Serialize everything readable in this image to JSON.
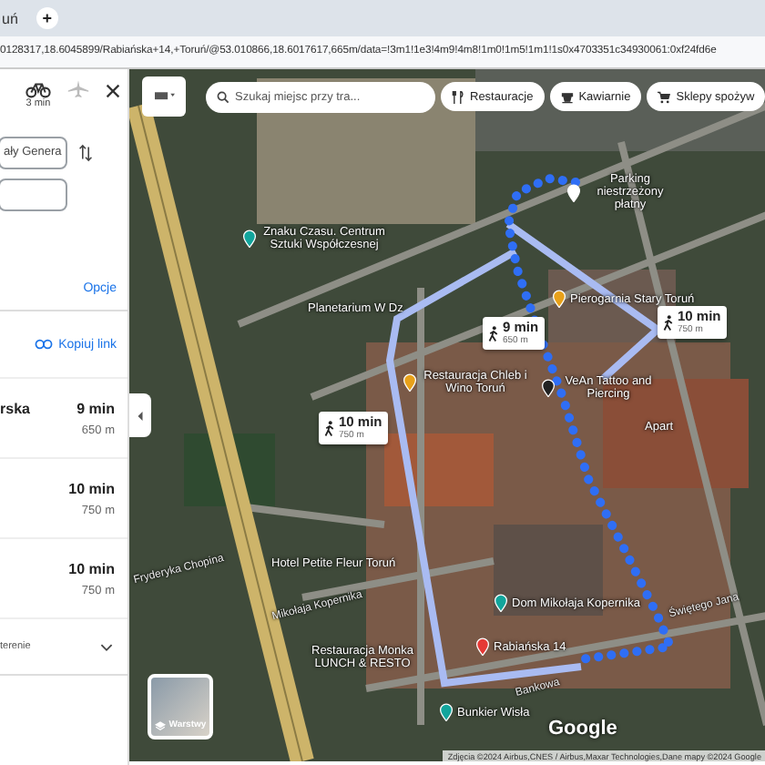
{
  "browser": {
    "tab_title": "uń",
    "new_tab": "+",
    "url": "0128317,18.6045899/Rabiańska+14,+Toruń/@53.010866,18.6017617,665m/data=!3m1!1e3!4m9!4m8!1m0!1m5!1m1!1s0x4703351c34930061:0xf24fd6e"
  },
  "directions": {
    "modes": [
      {
        "kind": "bike",
        "time": "3 min"
      },
      {
        "kind": "plane"
      }
    ],
    "origin": {
      "value": "ały Genera"
    },
    "options_link": "Opcje",
    "copy_link": "Kopiuj link",
    "routes": [
      {
        "name": "rska",
        "time": "9 min",
        "distance": "650 m"
      },
      {
        "time": "10 min",
        "distance": "750 m"
      },
      {
        "time": "10 min",
        "distance": "750 m"
      }
    ],
    "terrain": {
      "label": "terenie",
      "expanded": false
    }
  },
  "map": {
    "search": {
      "placeholder": "Szukaj miejsc przy tra..."
    },
    "chips": [
      {
        "kind": "restaurant",
        "label": "Restauracje"
      },
      {
        "kind": "cafe",
        "label": "Kawiarnie"
      },
      {
        "kind": "shop",
        "label": "Sklepy spożyw"
      }
    ],
    "route_labels": [
      {
        "time": "9 min",
        "distance": "650 m"
      },
      {
        "time": "10 min",
        "distance": "750 m"
      },
      {
        "time": "10 min",
        "distance": "750 m"
      }
    ],
    "places": [
      {
        "kind": "museum",
        "label": "Znaku Czasu. Centrum Sztuki Współczesnej"
      },
      {
        "kind": "parking",
        "label": "Parking niestrzeżony płatny"
      },
      {
        "kind": "restaurant",
        "label": "Pierogarnia Stary Toruń"
      },
      {
        "kind": "none",
        "label": "Planetarium W Dz"
      },
      {
        "kind": "restaurant",
        "label": "Restauracja Chleb i Wino Toruń"
      },
      {
        "kind": "shop",
        "label": "VeAn Tattoo and Piercing"
      },
      {
        "kind": "none",
        "label": "Apart"
      },
      {
        "kind": "none",
        "label": "Hotel Petite Fleur Toruń"
      },
      {
        "kind": "street",
        "label": "Mikołaja Kopernika"
      },
      {
        "kind": "none",
        "label": "Restauracja Monka LUNCH & RESTO"
      },
      {
        "kind": "museum",
        "label": "Dom Mikołaja Kopernika"
      },
      {
        "kind": "address",
        "label": "Rabiańska 14"
      },
      {
        "kind": "museum",
        "label": "Bunkier Wisła"
      },
      {
        "kind": "street",
        "label": "Fryderyka Chopina"
      },
      {
        "kind": "street",
        "label": "Bankowa"
      },
      {
        "kind": "street",
        "label": "Świętego Jana"
      }
    ],
    "layers_label": "Warstwy",
    "logo": "Google",
    "attribution": "Zdjęcia ©2024 Airbus,CNES / Airbus,Maxar Technologies,Dane mapy ©2024 Google"
  }
}
